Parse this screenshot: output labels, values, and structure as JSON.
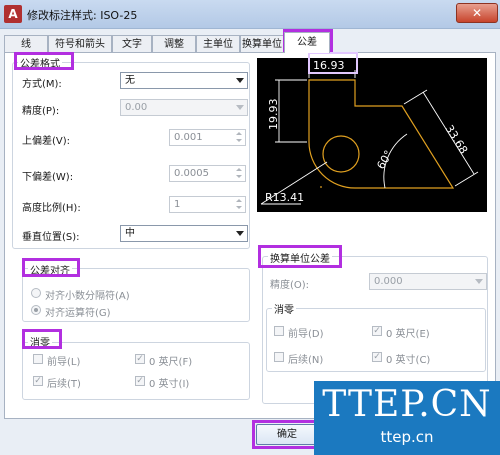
{
  "window": {
    "title": "修改标注样式: ISO-25",
    "app_icon": "autocad-icon",
    "close_glyph": "✕"
  },
  "tabs": [
    {
      "label": "线"
    },
    {
      "label": "符号和箭头"
    },
    {
      "label": "文字"
    },
    {
      "label": "调整"
    },
    {
      "label": "主单位"
    },
    {
      "label": "换算单位"
    },
    {
      "label": "公差"
    }
  ],
  "tolerance_format": {
    "title": "公差格式",
    "method_label": "方式(M):",
    "method_value": "无",
    "precision_label": "精度(P):",
    "precision_value": "0.00",
    "upper_label": "上偏差(V):",
    "upper_value": "0.001",
    "lower_label": "下偏差(W):",
    "lower_value": "0.0005",
    "scale_label": "高度比例(H):",
    "scale_value": "1",
    "vpos_label": "垂直位置(S):",
    "vpos_value": "中"
  },
  "tolerance_align": {
    "title": "公差对齐",
    "opt1": "对齐小数分隔符(A)",
    "opt2": "对齐运算符(G)",
    "opt2_selected": true
  },
  "zero_suppress": {
    "title": "消零",
    "leading": "前导(L)",
    "leading_checked": false,
    "trailing": "后续(T)",
    "trailing_checked": true,
    "feet": "0 英尺(F)",
    "feet_checked": true,
    "inches": "0 英寸(I)",
    "inches_checked": true
  },
  "preview": {
    "dim_top": "16.93",
    "dim_left": "19.93",
    "dim_slant": "33.68",
    "dim_angle": "60°",
    "dim_radius": "R13.41"
  },
  "alt_tolerance": {
    "title": "换算单位公差",
    "precision_label": "精度(O):",
    "precision_value": "0.000",
    "zero_title": "消零",
    "leading": "前导(D)",
    "leading_checked": false,
    "trailing": "后续(N)",
    "trailing_checked": false,
    "feet": "0 英尺(E)",
    "feet_checked": true,
    "inches": "0 英寸(C)",
    "inches_checked": true
  },
  "buttons": {
    "ok": "确定"
  },
  "watermark": {
    "big": "TTEP.CN",
    "small": "ttep.cn"
  },
  "colors": {
    "highlight": "#b22fe0",
    "dim_line": "#ffffff",
    "geometry": "#e0a020",
    "watermark": "#1b79c0"
  }
}
